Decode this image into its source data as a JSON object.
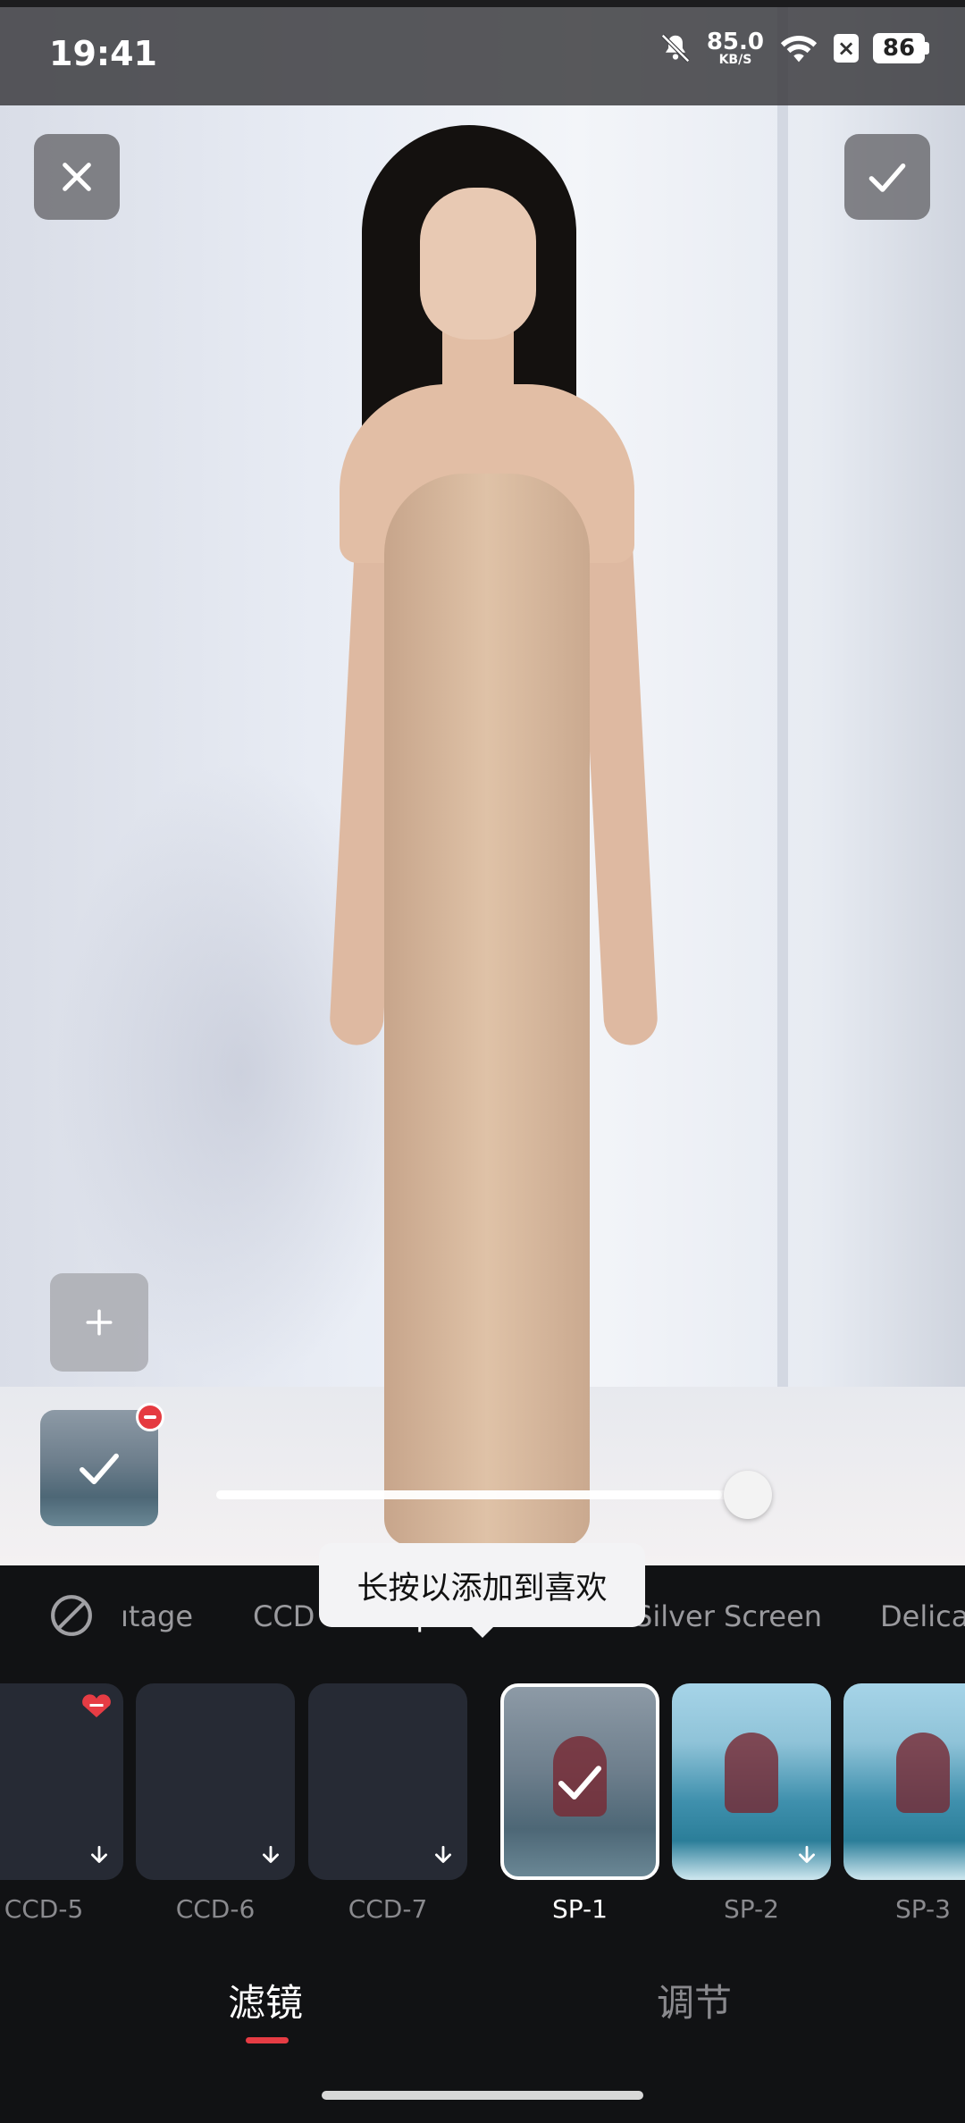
{
  "status_bar": {
    "time": "19:41",
    "net_speed": "85.0",
    "net_unit": "KB/S",
    "battery": "86"
  },
  "slider": {
    "value_fraction": 0.95
  },
  "categories": [
    {
      "label": "Vintage",
      "visible_text": "ıtage"
    },
    {
      "label": "CCD"
    },
    {
      "label": "Sport",
      "visible_text": "Sp"
    },
    {
      "label": "Silver Screen"
    },
    {
      "label": "Delicate",
      "visible_text": "Delica"
    }
  ],
  "tooltip": "长按以添加到喜欢",
  "filters": [
    {
      "name": "CCD-5",
      "favorite": true,
      "downloaded": false
    },
    {
      "name": "CCD-6",
      "favorite": false,
      "downloaded": false
    },
    {
      "name": "CCD-7",
      "favorite": false,
      "downloaded": false
    },
    {
      "name": "SP-1",
      "selected": true,
      "downloaded": true
    },
    {
      "name": "SP-2",
      "downloaded": false
    },
    {
      "name": "SP-3",
      "downloaded": false
    }
  ],
  "tabs": [
    {
      "label": "滤镜",
      "active": true
    },
    {
      "label": "调节",
      "active": false
    }
  ],
  "colors": {
    "accent": "#e63c44",
    "panel_bg": "#111214",
    "card_bg": "#262a34"
  }
}
